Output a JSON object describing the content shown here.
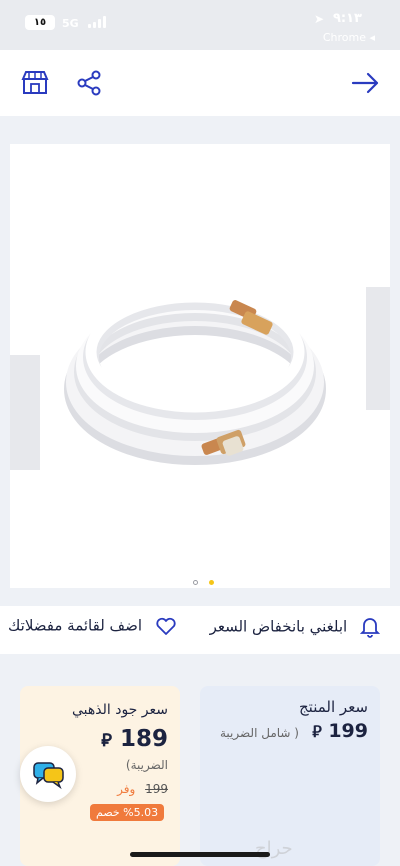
{
  "status_bar": {
    "time": "٩:١٣",
    "back_to_app": "Chrome ◂",
    "network": "5G",
    "battery": "١٥"
  },
  "actions": {
    "price_alert": "ابلغني بانخفاض السعر",
    "add_wishlist": "اضف لقائمة مفضلاتك"
  },
  "product_price_card": {
    "title": "سعر المنتج",
    "price": "199",
    "tax_note": "( شامل الضريبة"
  },
  "gold_price_card": {
    "title": "سعر جود الذهبي",
    "price": "189",
    "tax_note": "الضريبة)",
    "old_price": "199",
    "save_label": "وفر",
    "discount_badge": "%5.03 خصم"
  },
  "carousel": {
    "active_index": 0,
    "count": 2
  },
  "watermark": "حراج",
  "colors": {
    "accent": "#2a6fd6",
    "discount_orange": "#f07a3c",
    "price_card_bg": "#e6ecf7",
    "gold_card_bg": "#fdf3e3",
    "dot_active": "#f5c518"
  }
}
